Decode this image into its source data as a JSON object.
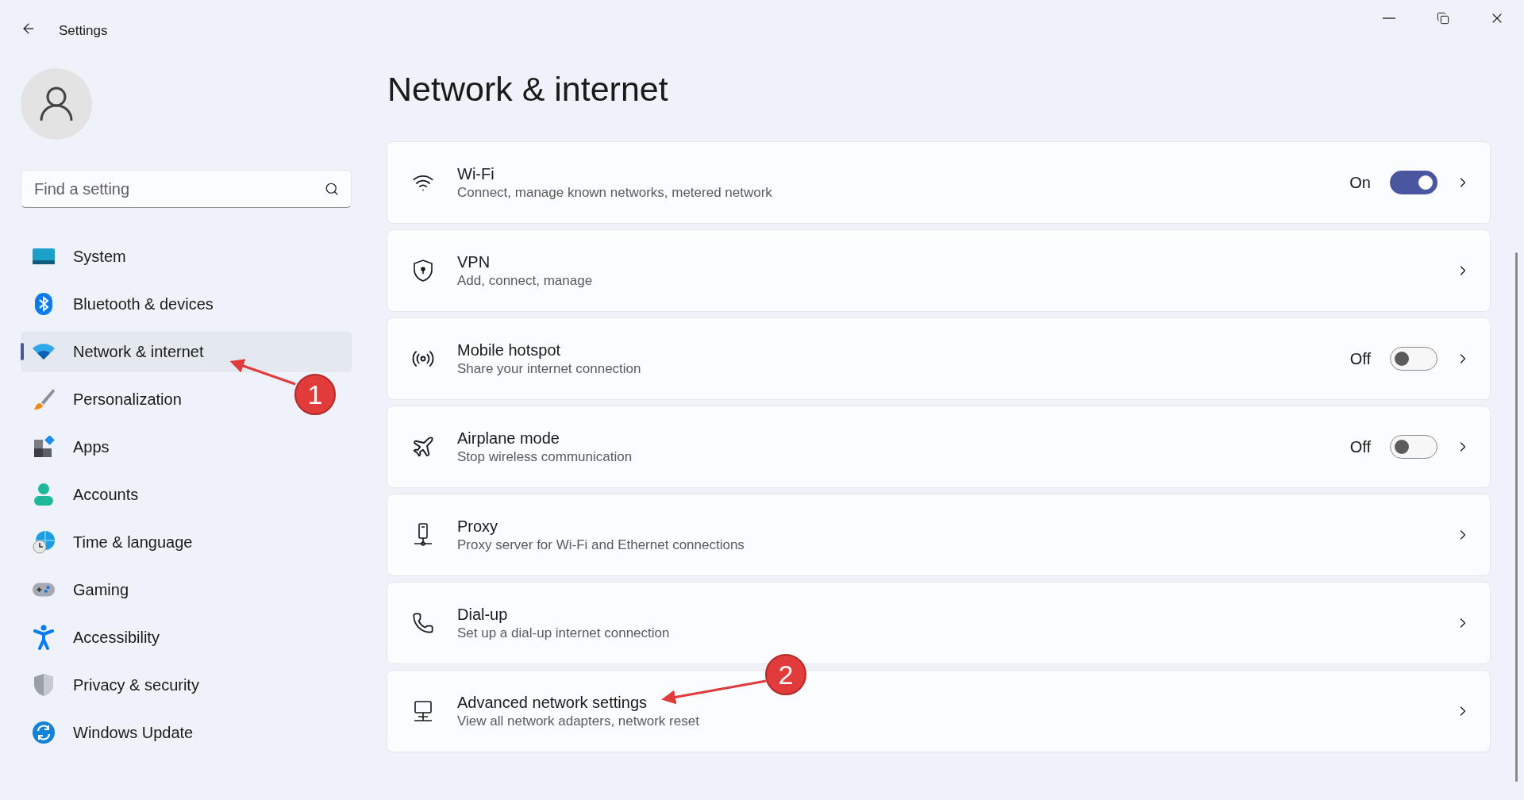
{
  "window": {
    "title": "Settings"
  },
  "search": {
    "placeholder": "Find a setting"
  },
  "sidebar": {
    "items": [
      {
        "label": "System",
        "selected": false
      },
      {
        "label": "Bluetooth & devices",
        "selected": false
      },
      {
        "label": "Network & internet",
        "selected": true
      },
      {
        "label": "Personalization",
        "selected": false
      },
      {
        "label": "Apps",
        "selected": false
      },
      {
        "label": "Accounts",
        "selected": false
      },
      {
        "label": "Time & language",
        "selected": false
      },
      {
        "label": "Gaming",
        "selected": false
      },
      {
        "label": "Accessibility",
        "selected": false
      },
      {
        "label": "Privacy & security",
        "selected": false
      },
      {
        "label": "Windows Update",
        "selected": false
      }
    ]
  },
  "page": {
    "heading": "Network & internet"
  },
  "cards": [
    {
      "title": "Wi-Fi",
      "subtitle": "Connect, manage known networks, metered network",
      "toggle": {
        "label": "On",
        "on": true
      }
    },
    {
      "title": "VPN",
      "subtitle": "Add, connect, manage"
    },
    {
      "title": "Mobile hotspot",
      "subtitle": "Share your internet connection",
      "toggle": {
        "label": "Off",
        "on": false
      }
    },
    {
      "title": "Airplane mode",
      "subtitle": "Stop wireless communication",
      "toggle": {
        "label": "Off",
        "on": false
      }
    },
    {
      "title": "Proxy",
      "subtitle": "Proxy server for Wi-Fi and Ethernet connections"
    },
    {
      "title": "Dial-up",
      "subtitle": "Set up a dial-up internet connection"
    },
    {
      "title": "Advanced network settings",
      "subtitle": "View all network adapters, network reset"
    }
  ],
  "annotations": [
    {
      "number": "1"
    },
    {
      "number": "2"
    }
  ]
}
